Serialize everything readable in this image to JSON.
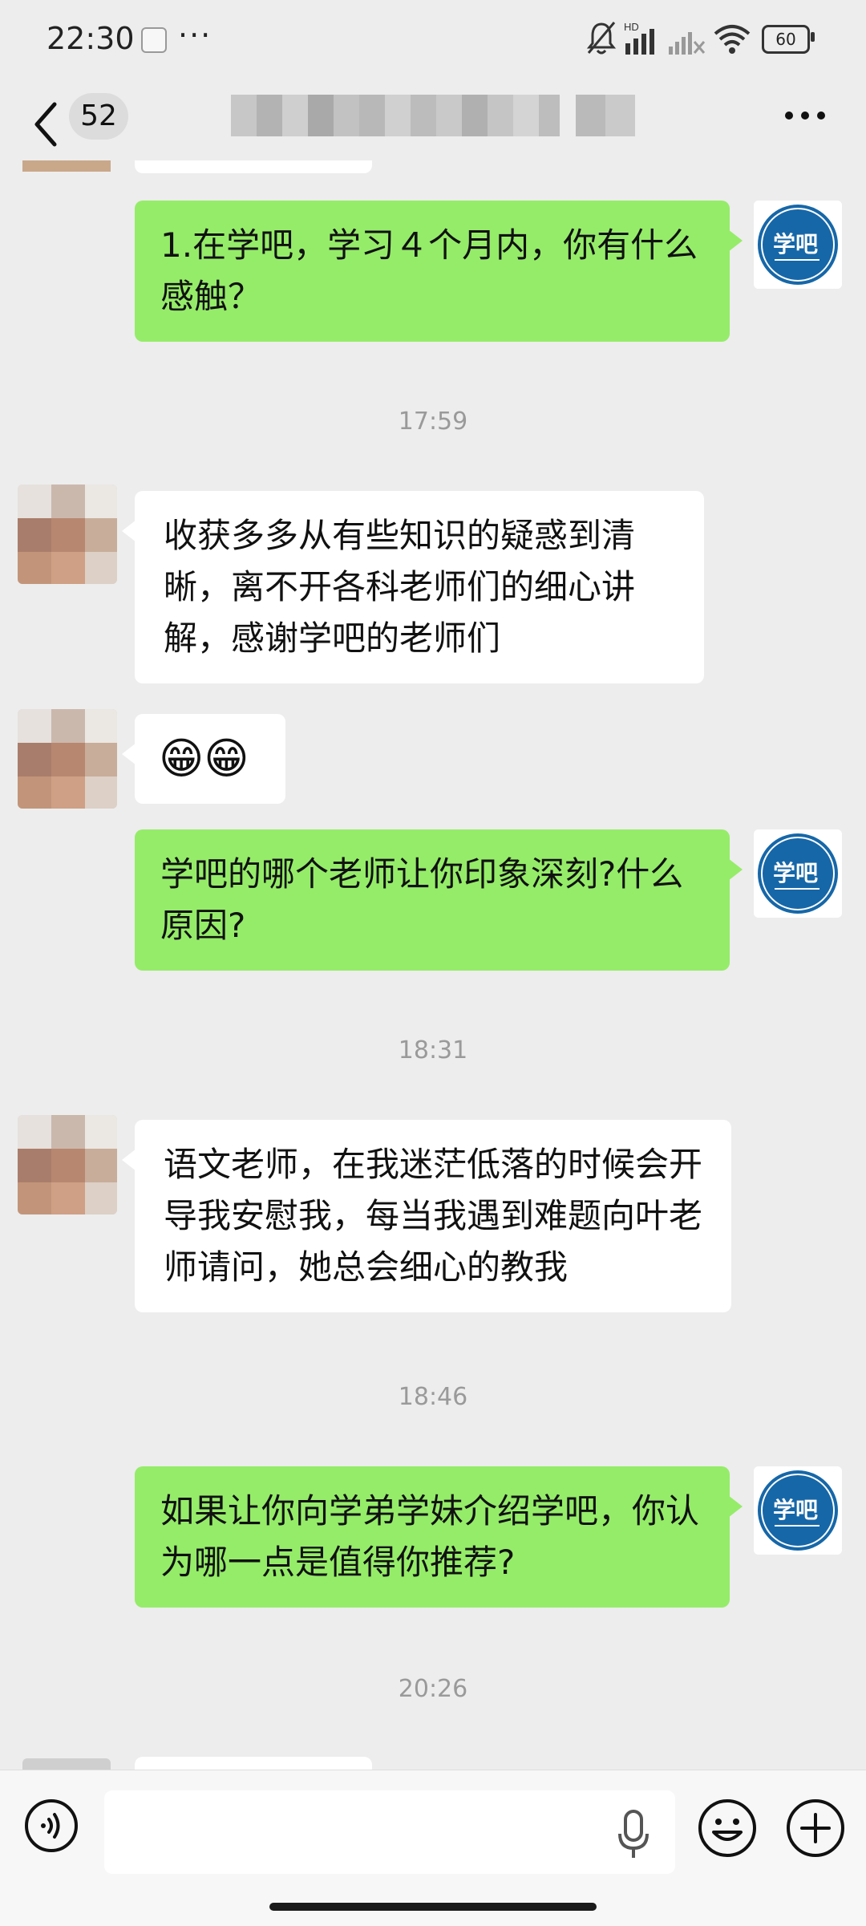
{
  "status_bar": {
    "time": "22:30",
    "more": "···",
    "network_label": "HD",
    "battery": "60"
  },
  "header": {
    "unread_count": "52",
    "title": "",
    "icons": {
      "back": "chevron-left-icon",
      "more": "more-dots-icon"
    }
  },
  "messages": [
    {
      "side": "right",
      "text": "1.在学吧，学习４个月内，你有什么感触？"
    },
    {
      "type": "time",
      "text": "17:59"
    },
    {
      "side": "left",
      "text": "收获多多从有些知识的疑惑到清晰，离不开各科老师们的细心讲解，感谢学吧的老师们"
    },
    {
      "side": "left",
      "text": "😁😁"
    },
    {
      "side": "right",
      "text": "学吧的哪个老师让你印象深刻?什么原因?"
    },
    {
      "type": "time",
      "text": "18:31"
    },
    {
      "side": "left",
      "text": "语文老师，在我迷茫低落的时候会开导我安慰我，每当我遇到难题向叶老师请问，她总会细心的教我"
    },
    {
      "type": "time",
      "text": "18:46"
    },
    {
      "side": "right",
      "text": "如果让你向学弟学妹介绍学吧，你认为哪一点是值得你推荐?"
    },
    {
      "type": "time",
      "text": "20:26"
    }
  ],
  "logo": {
    "text": "学吧"
  },
  "input_bar": {
    "placeholder": "",
    "icons": [
      "voice-icon",
      "mic-icon",
      "emoji-icon",
      "plus-icon"
    ]
  },
  "colors": {
    "background": "#ededed",
    "sent_bubble": "#95ec69",
    "received_bubble": "#ffffff",
    "logo_blue": "#1667a8"
  }
}
